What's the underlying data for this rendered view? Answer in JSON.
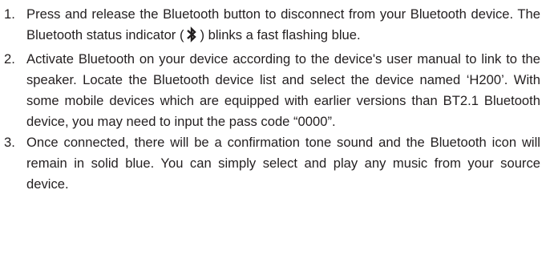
{
  "steps": [
    {
      "number": "1.",
      "text_before_icon": "Press and release the Bluetooth button to disconnect from your Bluetooth device. The Bluetooth status indicator (",
      "icon": "bluetooth-icon",
      "text_after_icon": ") blinks a fast flashing blue."
    },
    {
      "number": "2.",
      "text": "Activate Bluetooth on your device according to the device's user manual to link to the speaker. Locate the Bluetooth device list and select the device named ‘H200’. With some mobile devices which are equipped with earlier versions than BT2.1 Bluetooth device, you may need to input the pass code “0000”."
    },
    {
      "number": "3.",
      "text": "Once connected, there will be a confirmation tone sound and the Bluetooth icon will remain in solid blue. You can simply select and play any music from your source device."
    }
  ]
}
